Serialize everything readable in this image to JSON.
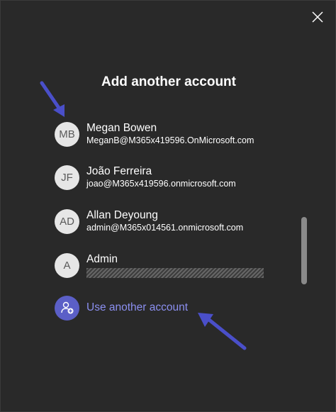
{
  "dialog": {
    "title": "Add another account"
  },
  "accounts": [
    {
      "initials": "MB",
      "name": "Megan Bowen",
      "email": "MeganB@M365x419596.OnMicrosoft.com"
    },
    {
      "initials": "JF",
      "name": "João Ferreira",
      "email": "joao@M365x419596.onmicrosoft.com"
    },
    {
      "initials": "AD",
      "name": "Allan Deyoung",
      "email": "admin@M365x014561.onmicrosoft.com"
    },
    {
      "initials": "A",
      "name": "Admin"
    }
  ],
  "use_another": {
    "label": "Use another account",
    "icon": "add-person-icon"
  },
  "icons": {
    "close": "close-icon"
  },
  "colors": {
    "background": "#292929",
    "accent": "#5b5fc7",
    "accent_text": "#8b8ff0",
    "avatar_bg": "#e6e6e6",
    "annotation_arrow": "#4a4fc9"
  }
}
